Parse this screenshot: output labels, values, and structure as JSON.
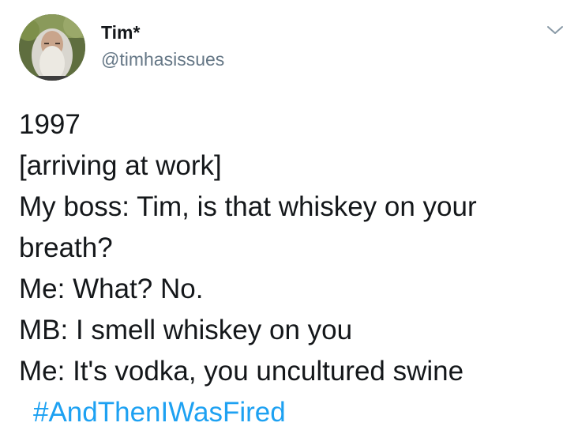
{
  "author": {
    "display_name": "Tim*",
    "handle": "@timhasissues",
    "avatar_icon": "bearded-man-avatar"
  },
  "tweet": {
    "lines": [
      "1997",
      "[arriving at work]",
      "My boss: Tim, is that whiskey on your",
      "breath?",
      "Me: What? No.",
      "MB: I smell whiskey on you",
      "Me: It's vodka, you uncultured swine"
    ],
    "hashtag": "#AndThenIWasFired"
  },
  "menu": {
    "icon": "chevron-down-icon"
  },
  "colors": {
    "text": "#14171a",
    "secondary": "#657786",
    "link": "#1da1f2",
    "background": "#ffffff"
  }
}
